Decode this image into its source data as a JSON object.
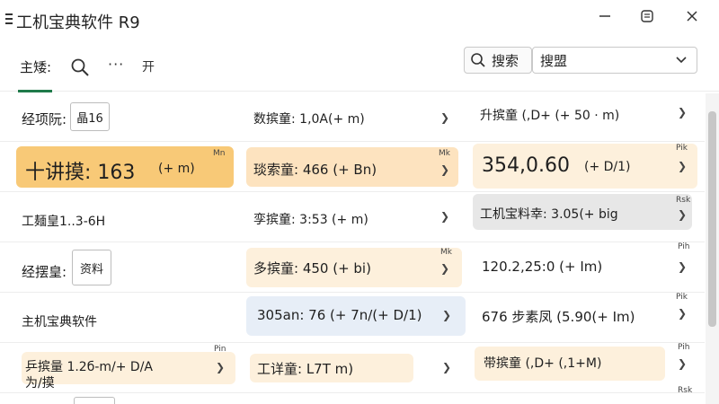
{
  "window": {
    "title": "工机宝典软件 R9"
  },
  "toolbar": {
    "tab_main": "主矮:",
    "more": "···",
    "open": "开",
    "search_button": "搜索",
    "search_select_value": "搜盟"
  },
  "rows": [
    {
      "c1": {
        "label": "经项阮:",
        "chip": "晶16"
      },
      "c2": {
        "text": "数摈童: 1,0A(+ m)"
      },
      "c3": {
        "text": "升摈童 (,D+ (+ 50 · m)"
      }
    },
    {
      "c1": {
        "text": "十讲摸: 163",
        "suffix": "(+ m)",
        "tag": "Mn"
      },
      "c2": {
        "text": "琰索童: 466 (+ Bn)",
        "tag": "Mk"
      },
      "c3": {
        "text": "354,0.60",
        "suffix": "(+ D/1)",
        "tag": "Pik"
      }
    },
    {
      "c1": {
        "text": "工麺皇1..3-6H"
      },
      "c2": {
        "text": "孪摈童: 3:53 (+ m)"
      },
      "c3": {
        "text": "工机宝料幸: 3.05(+ big",
        "tag": "Rsk"
      }
    },
    {
      "c1": {
        "label": "经摆皇:",
        "chip": "资料"
      },
      "c2": {
        "text": "多摈童: 450 (+ bi)",
        "tag": "Mk"
      },
      "c3": {
        "text": "120.2,25:0 (+ Im)",
        "tag": "Pih"
      }
    },
    {
      "c1": {
        "text": "主机宝典软件"
      },
      "c2": {
        "text": "305an: 76 (+ 7n/(+ D/1)"
      },
      "c3": {
        "text": "676 步素凤 (5.90(+ Im)",
        "tag": "Pik"
      }
    },
    {
      "c1": {
        "text": "乒摈量 1.2б-m/+ D/A",
        "sub": "为/摸",
        "tag": "Pin"
      },
      "c2": {
        "text": "工详童: L7T m)"
      },
      "c3": {
        "text": "带摈童 (,D+ (,1+M)",
        "tag": "Pih"
      }
    }
  ],
  "bottom": {
    "tag": "Rsk"
  }
}
